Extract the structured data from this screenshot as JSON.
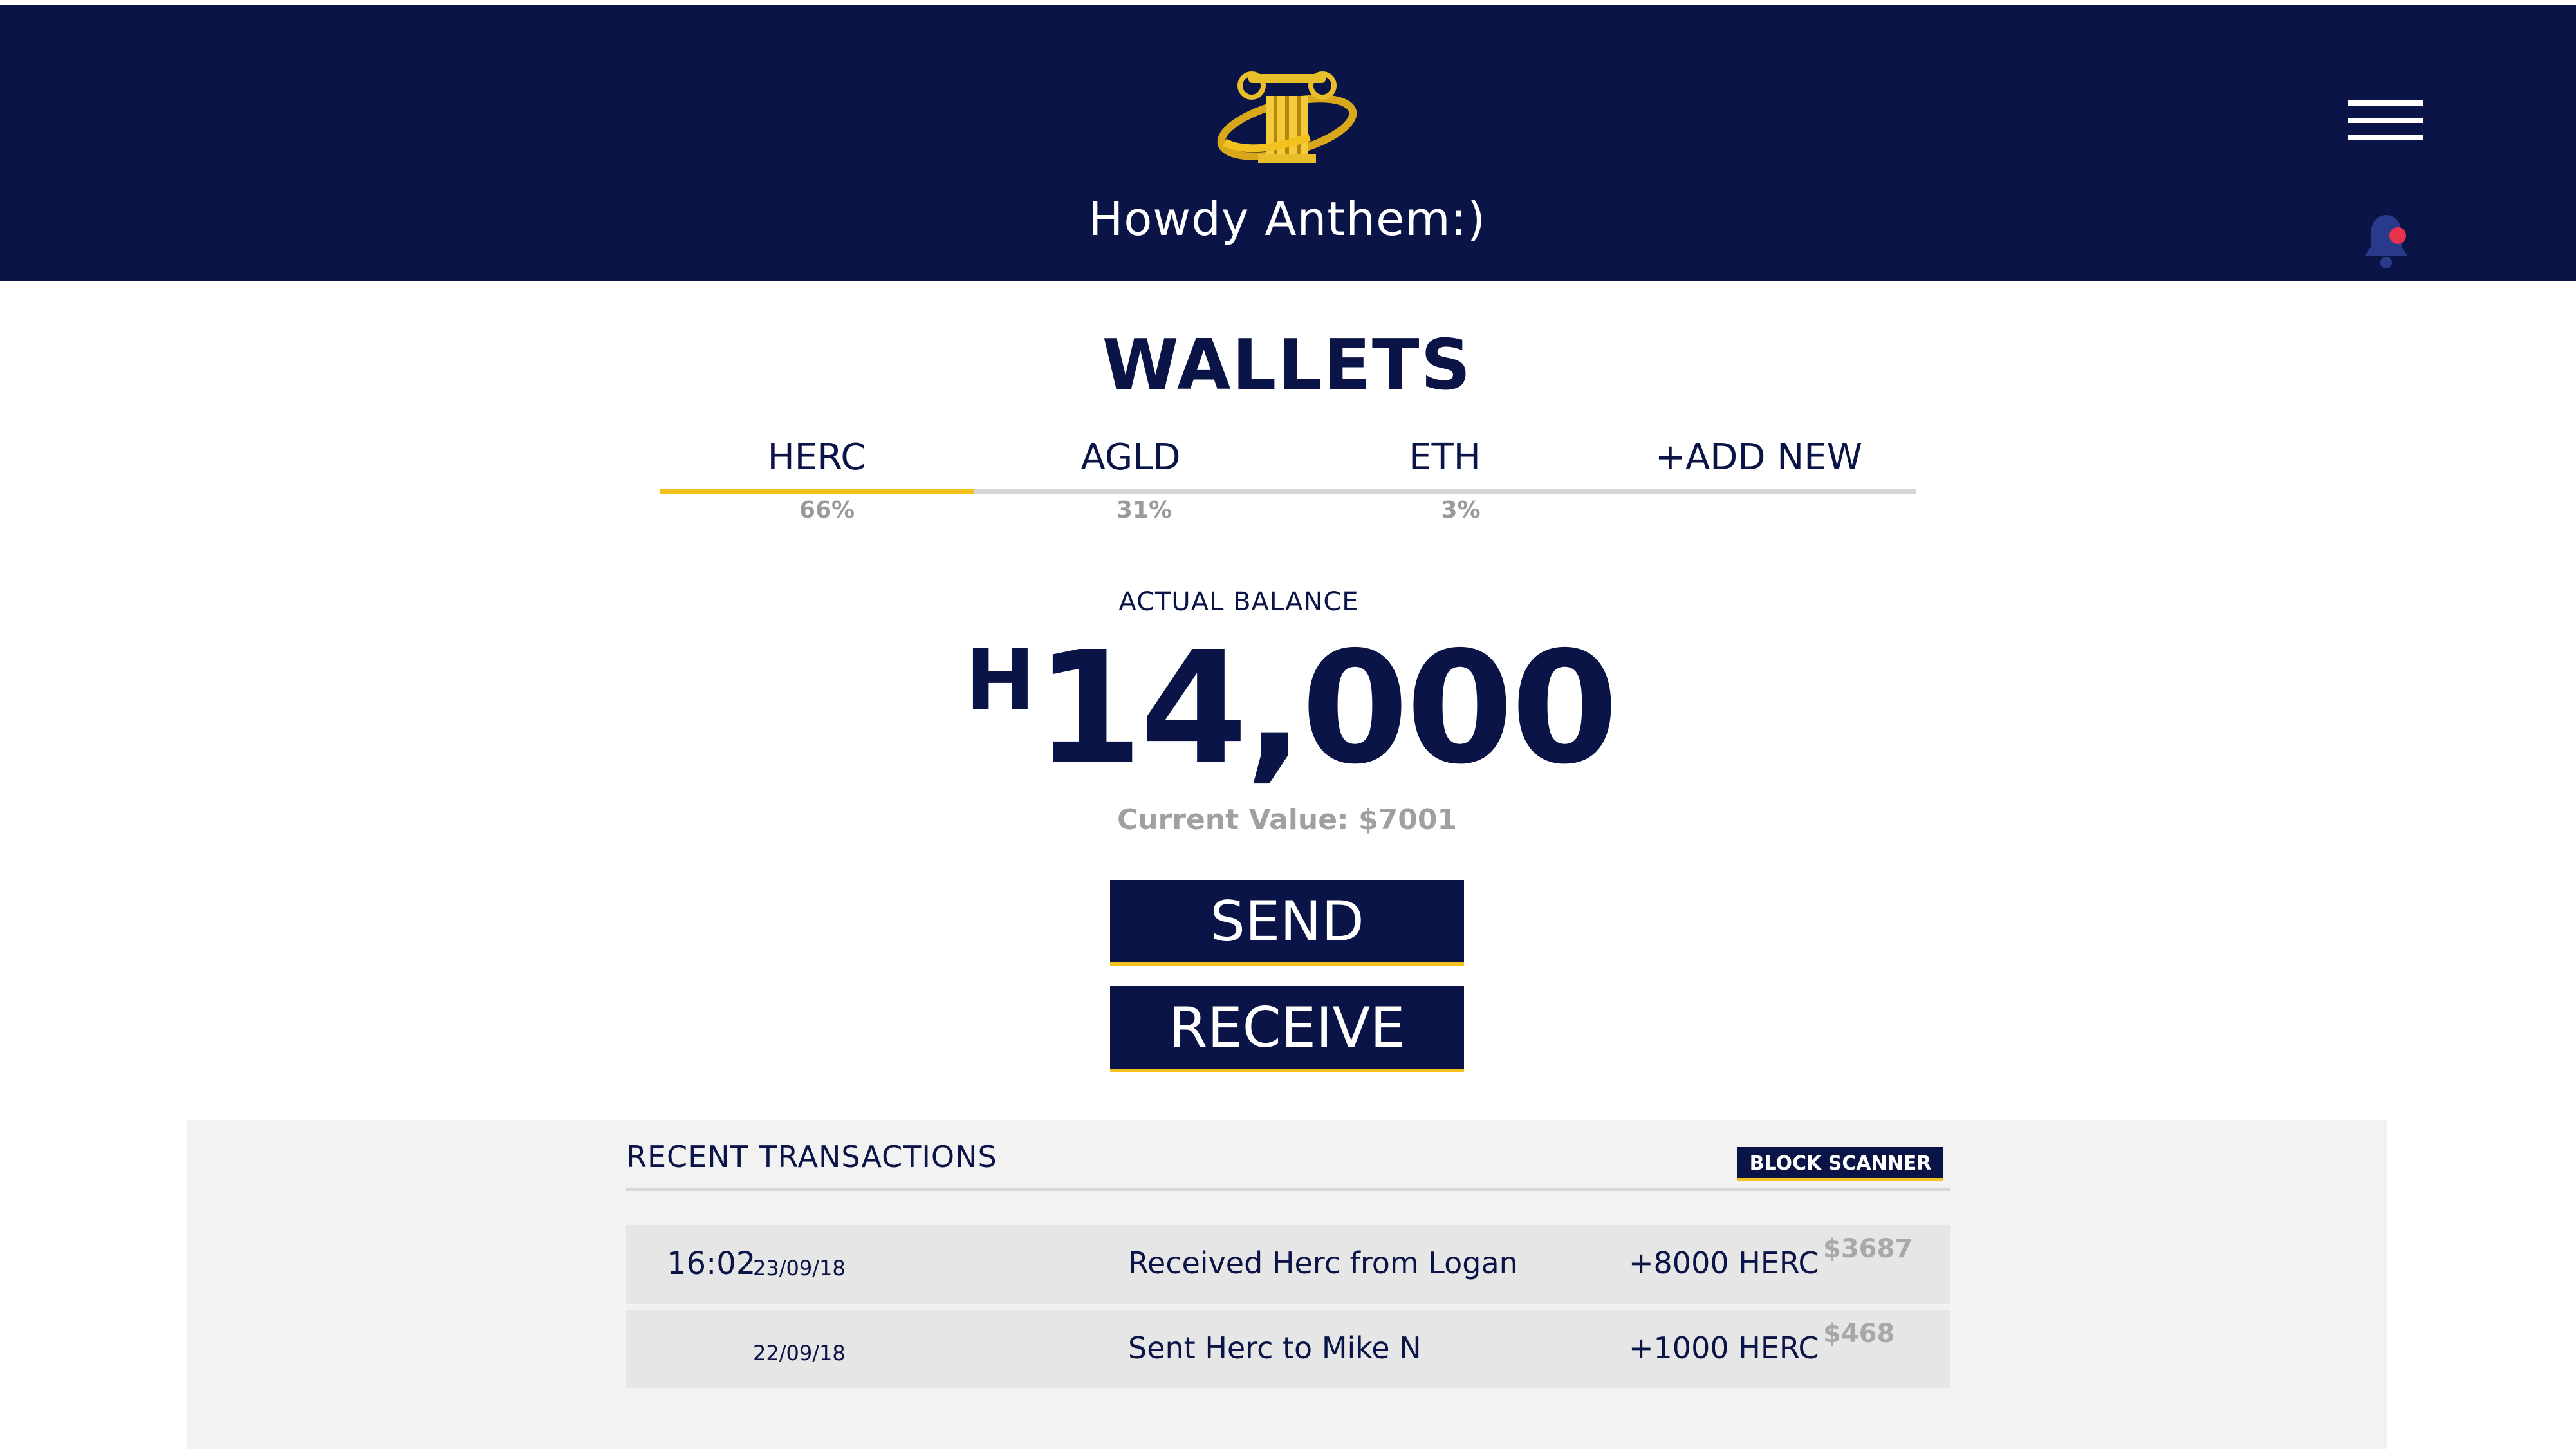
{
  "header": {
    "greeting": "Howdy Anthem:)",
    "logo_icon": "column-logo-icon",
    "menu_icon": "hamburger-menu-icon",
    "notification_icon": "bell-icon",
    "colors": {
      "navy": "#0b1446",
      "gold": "#f2c11d",
      "alert": "#e8314a"
    }
  },
  "wallets": {
    "title": "WALLETS",
    "tabs": [
      {
        "label": "HERC",
        "percent": "66%",
        "active": true
      },
      {
        "label": "AGLD",
        "percent": "31%",
        "active": false
      },
      {
        "label": "ETH",
        "percent": "3%",
        "active": false
      },
      {
        "label": "+ADD NEW",
        "percent": "",
        "active": false
      }
    ]
  },
  "balance": {
    "label": "ACTUAL BALANCE",
    "currency_symbol": "H",
    "amount": "14,000",
    "current_value": "Current Value: $7001"
  },
  "actions": {
    "send_label": "SEND",
    "receive_label": "RECEIVE"
  },
  "transactions": {
    "title": "RECENT TRANSACTIONS",
    "block_scanner_label": "BLOCK SCANNER",
    "rows": [
      {
        "time": "16:02",
        "date": "23/09/18",
        "description": "Received Herc from Logan",
        "amount": "+8000 HERC",
        "usd": "$3687"
      },
      {
        "time": "",
        "date": "22/09/18",
        "description": "Sent Herc to Mike N",
        "amount": "+1000 HERC",
        "usd": "$468"
      }
    ]
  }
}
